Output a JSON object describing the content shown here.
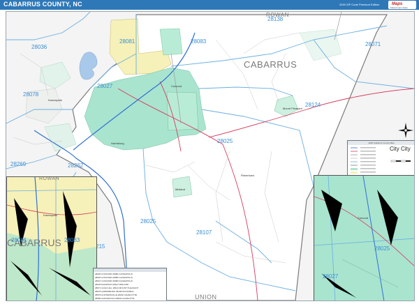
{
  "banner": {
    "title": "CABARRUS COUNTY, NC",
    "subtitle": "2020 ZIP Code Premium Edition",
    "logo_name": "Maps",
    "logo_tagline": "Marketmaps Sales"
  },
  "counties": {
    "rowan_main": "ROWAN",
    "cabarrus_main": "CABARRUS",
    "union_main": "UNION",
    "rowan_inset": "ROWAN",
    "cabarrus_inset": "CABARRUS"
  },
  "zips": {
    "z28138": "28138",
    "z28081_top": "28081",
    "z28083": "28083",
    "z28071": "28071",
    "z28036": "28036",
    "z28027": "28027",
    "z28078": "28078",
    "z28124": "28124",
    "z28025": "28025",
    "z28269": "28269",
    "z28262": "28262",
    "z28025_b": "28025",
    "z28107": "28107",
    "z28081_inset": "28081",
    "z28083_inset": "28083",
    "z28025_inset": "28025",
    "z28027_inset": "28027",
    "z28215": "215"
  },
  "towns": {
    "kannapolis": "Kannapolis",
    "concord": "Concord",
    "mount_pleasant": "Mount Pleasant",
    "harrisburg": "Harrisburg",
    "midland": "Midland",
    "rimertown": "Rimertown",
    "inset_kannapolis": "Kannapolis",
    "inset_concord": "Concord"
  },
  "legend": {
    "header": "2020 Cabarrus County Map",
    "scale_label": "City City"
  },
  "key": {
    "rows": [
      "28025 CONCORD      28081 KANNAPOLIS",
      "28026 CONCORD      28082 KANNAPOLIS",
      "28027 CONCORD      28083 KANNAPOLIS",
      "28036 DAVIDSON     28107 MIDLAND",
      "28071 GOLD HILL    28124 MOUNT PLEASANT",
      "28075 HARRISBURG   28138 ROCKWELL",
      "28078 HUNTERSVILLE 28262 CHARLOTTE",
      "28080 KANNAPOLIS   28269 CHARLOTTE"
    ]
  },
  "colors": {
    "banner": "#2f78b8",
    "zip_label": "#3a8fd6",
    "urban_green": "#a9e4cf",
    "urban_yellow": "#f6f1b8",
    "county_bg": "#f7f7f7",
    "road_red": "#d63c5e",
    "road_blue": "#2f6fd0"
  },
  "icons": {
    "compass": "north-arrow-compass-icon",
    "logo": "marketmaps-logo-icon"
  }
}
